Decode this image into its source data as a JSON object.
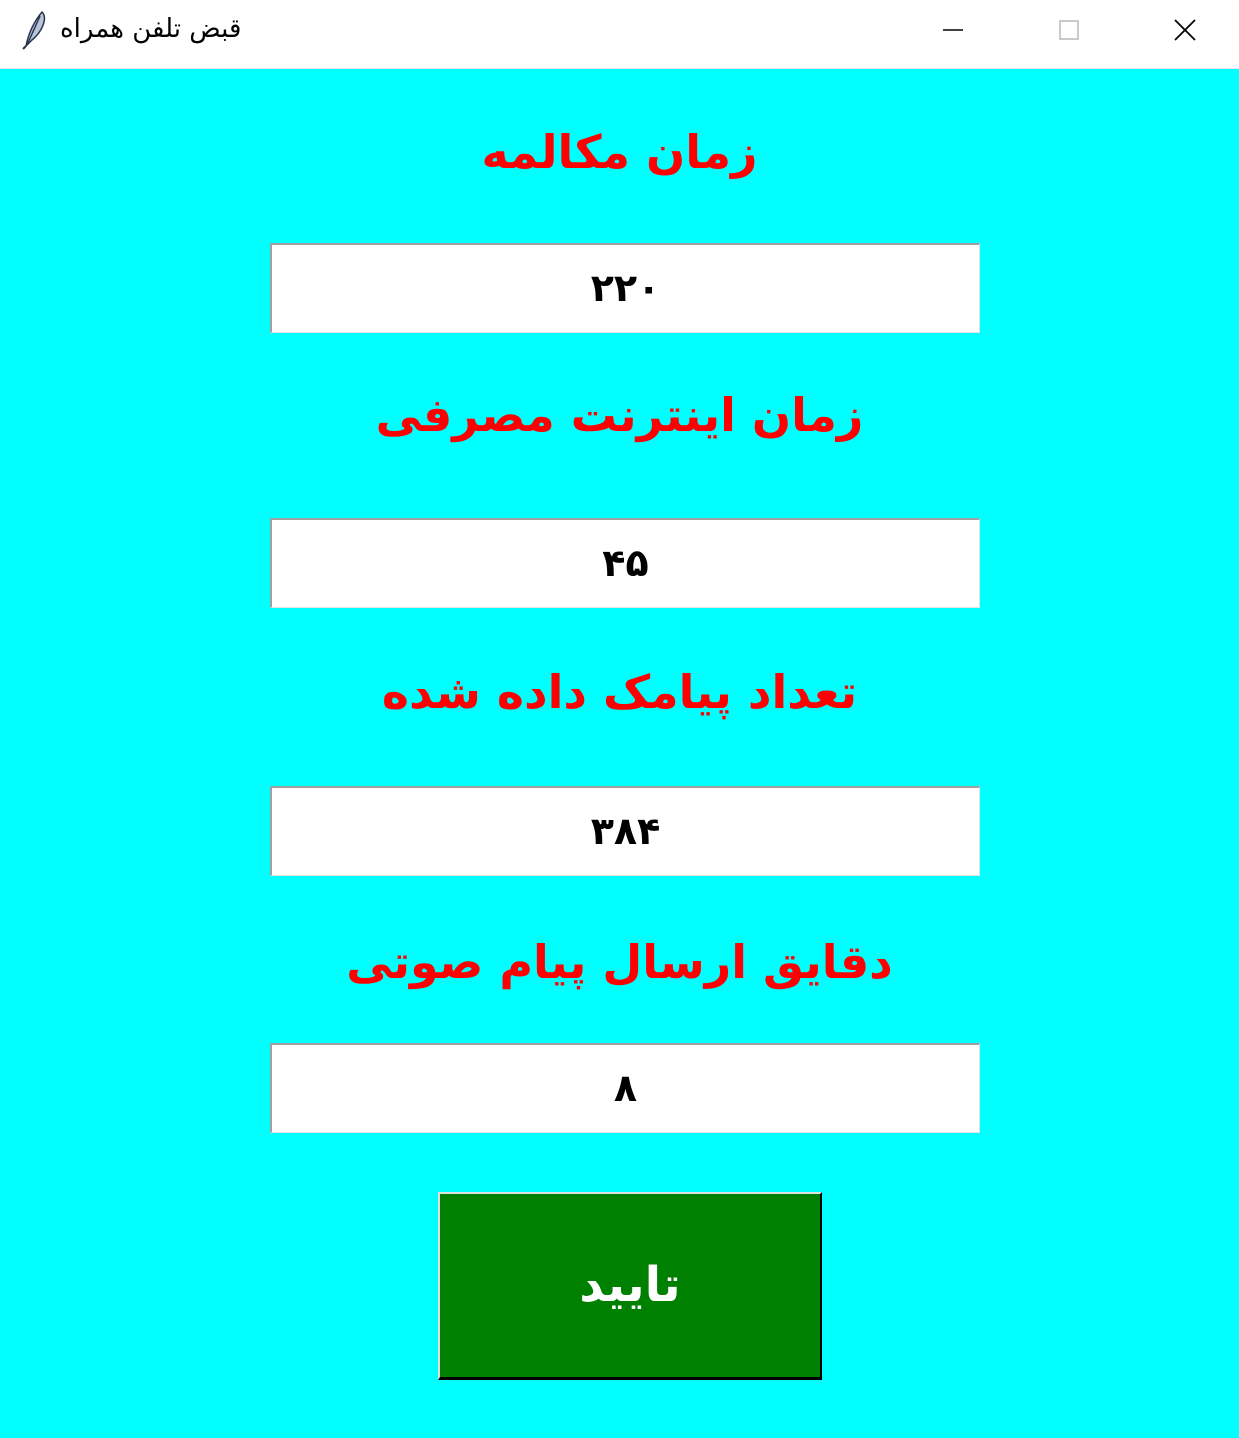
{
  "window": {
    "title": "قبض تلفن همراه",
    "icon": "feather-icon"
  },
  "form": {
    "call_time_label": "زمان مکالمه",
    "call_time_value": "۲۲۰",
    "internet_time_label": "زمان اینترنت مصرفی",
    "internet_time_value": "۴۵",
    "sms_count_label": "تعداد پیامک داده شده",
    "sms_count_value": "۳۸۴",
    "voice_minutes_label": "دقایق ارسال پیام صوتی",
    "voice_minutes_value": "۸",
    "submit_label": "تایید"
  },
  "colors": {
    "background": "#00ffff",
    "label": "#ff0000",
    "button": "#008000",
    "button_text": "#ffffff"
  }
}
